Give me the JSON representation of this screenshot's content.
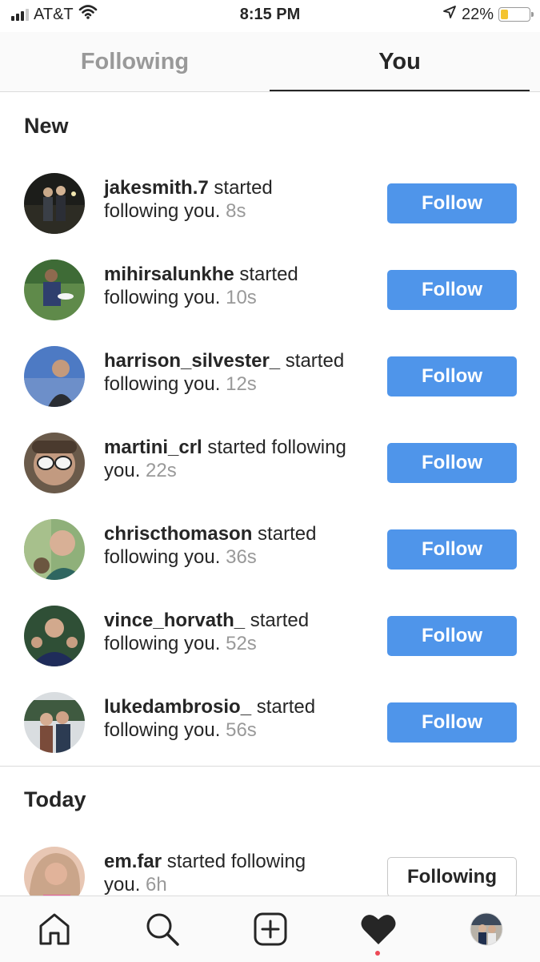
{
  "status_bar": {
    "carrier": "AT&T",
    "time": "8:15 PM",
    "battery": "22%",
    "battery_level": 0.22,
    "icons": [
      "signal-icon",
      "wifi-icon",
      "location-arrow-icon",
      "battery-icon"
    ]
  },
  "tabs": [
    {
      "label": "Following",
      "active": false
    },
    {
      "label": "You",
      "active": true
    }
  ],
  "sections": {
    "new_title": "New",
    "today_title": "Today"
  },
  "notifications_new": [
    {
      "username": "jakesmith.7",
      "action_line1": " started",
      "action_line2": "following you.",
      "time": "8s",
      "button": "Follow"
    },
    {
      "username": "mihirsalunkhe",
      "action_line1": " started",
      "action_line2": "following you.",
      "time": "10s",
      "button": "Follow"
    },
    {
      "username": "harrison_silvester_",
      "action_line1": " started",
      "action_line2": "following you.",
      "time": "12s",
      "button": "Follow"
    },
    {
      "username": "martini_crl",
      "action_line1": " started following",
      "action_line2": "you.",
      "time": "22s",
      "button": "Follow"
    },
    {
      "username": "chriscthomason",
      "action_line1": " started",
      "action_line2": "following you.",
      "time": "36s",
      "button": "Follow"
    },
    {
      "username": "vince_horvath_",
      "action_line1": " started",
      "action_line2": "following you.",
      "time": "52s",
      "button": "Follow"
    },
    {
      "username": "lukedambrosio_",
      "action_line1": " started",
      "action_line2": "following you.",
      "time": "56s",
      "button": "Follow"
    }
  ],
  "notifications_today": [
    {
      "username": "em.far",
      "action_line1": " started following",
      "action_line2": "you.",
      "time": "6h",
      "button": "Following"
    }
  ],
  "colors": {
    "accent": "#4f95ea",
    "text": "#262626",
    "muted": "#999999",
    "activity_dot": "#ed4956"
  },
  "nav": [
    "home-icon",
    "search-icon",
    "add-post-icon",
    "activity-heart-icon",
    "profile-avatar"
  ]
}
